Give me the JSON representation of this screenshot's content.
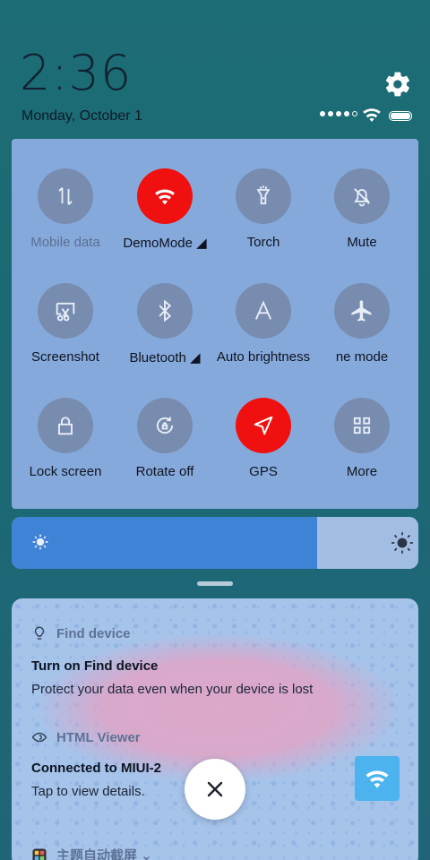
{
  "status": {
    "time": "2:36",
    "date": "Monday, October 1"
  },
  "quick_settings": {
    "tiles": [
      {
        "label": "Mobile data",
        "icon": "mobile-data-icon",
        "active": false,
        "dim": true
      },
      {
        "label": "DemoMode ◢",
        "icon": "wifi-icon",
        "active": true
      },
      {
        "label": "Torch",
        "icon": "flashlight-icon",
        "active": false
      },
      {
        "label": "Mute",
        "icon": "bell-off-icon",
        "active": false
      },
      {
        "label": "Screenshot",
        "icon": "screenshot-icon",
        "active": false
      },
      {
        "label": "Bluetooth ◢",
        "icon": "bluetooth-icon",
        "active": false
      },
      {
        "label": "Auto brightness",
        "icon": "auto-brightness-icon",
        "active": false
      },
      {
        "label": "ne mode",
        "icon": "airplane-icon",
        "active": false
      },
      {
        "label": "Lock screen",
        "icon": "lock-icon",
        "active": false
      },
      {
        "label": "Rotate off",
        "icon": "rotate-lock-icon",
        "active": false
      },
      {
        "label": "GPS",
        "icon": "location-arrow-icon",
        "active": true
      },
      {
        "label": "More",
        "icon": "grid-icon",
        "active": false
      }
    ]
  },
  "brightness": {
    "level": 0.75
  },
  "notifications": [
    {
      "app": "Find device",
      "title": "Turn on Find device",
      "text": "Protect your data even when your device is lost"
    },
    {
      "app": "HTML Viewer",
      "title": "Connected to MIUI-2",
      "text": "Tap to view details."
    },
    {
      "app": "主题自动截屏 ⌄"
    }
  ],
  "colors": {
    "accent_red": "#f01010",
    "slider_fill": "#3f83d6",
    "wifi_badge": "#4cb3ee"
  }
}
